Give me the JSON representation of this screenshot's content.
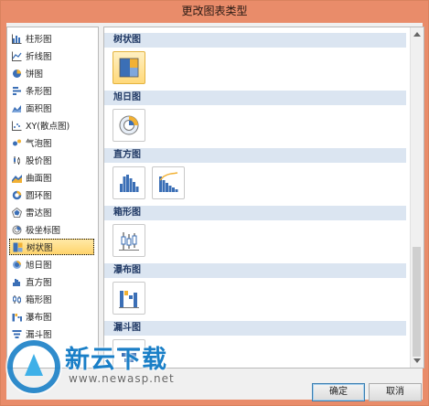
{
  "window": {
    "title": "更改图表类型"
  },
  "sidebar": {
    "items": [
      {
        "label": "柱形图",
        "icon": "column-chart-icon"
      },
      {
        "label": "折线图",
        "icon": "line-chart-icon"
      },
      {
        "label": "饼图",
        "icon": "pie-chart-icon"
      },
      {
        "label": "条形图",
        "icon": "bar-chart-icon"
      },
      {
        "label": "面积图",
        "icon": "area-chart-icon"
      },
      {
        "label": "XY(散点图)",
        "icon": "scatter-chart-icon"
      },
      {
        "label": "气泡图",
        "icon": "bubble-chart-icon"
      },
      {
        "label": "股价图",
        "icon": "stock-chart-icon"
      },
      {
        "label": "曲面图",
        "icon": "surface-chart-icon"
      },
      {
        "label": "圆环图",
        "icon": "doughnut-chart-icon"
      },
      {
        "label": "雷达图",
        "icon": "radar-chart-icon"
      },
      {
        "label": "极坐标图",
        "icon": "polar-chart-icon"
      },
      {
        "label": "树状图",
        "icon": "treemap-chart-icon",
        "selected": true
      },
      {
        "label": "旭日图",
        "icon": "sunburst-chart-icon"
      },
      {
        "label": "直方图",
        "icon": "histogram-chart-icon"
      },
      {
        "label": "箱形图",
        "icon": "boxplot-chart-icon"
      },
      {
        "label": "瀑布图",
        "icon": "waterfall-chart-icon"
      },
      {
        "label": "漏斗图",
        "icon": "funnel-chart-icon"
      }
    ]
  },
  "main": {
    "sections": [
      {
        "title": "树状图"
      },
      {
        "title": "旭日图"
      },
      {
        "title": "直方图"
      },
      {
        "title": "箱形图"
      },
      {
        "title": "瀑布图"
      },
      {
        "title": "漏斗图"
      }
    ]
  },
  "buttons": {
    "ok": "确定",
    "cancel": "取消"
  },
  "watermark": {
    "brand": "新云下载",
    "url": "www.newasp.net"
  },
  "colors": {
    "titlebar": "#e98c6a",
    "section_header": "#dbe5f1",
    "selected": "#ffd46c",
    "accent": "#1a7fc7"
  }
}
